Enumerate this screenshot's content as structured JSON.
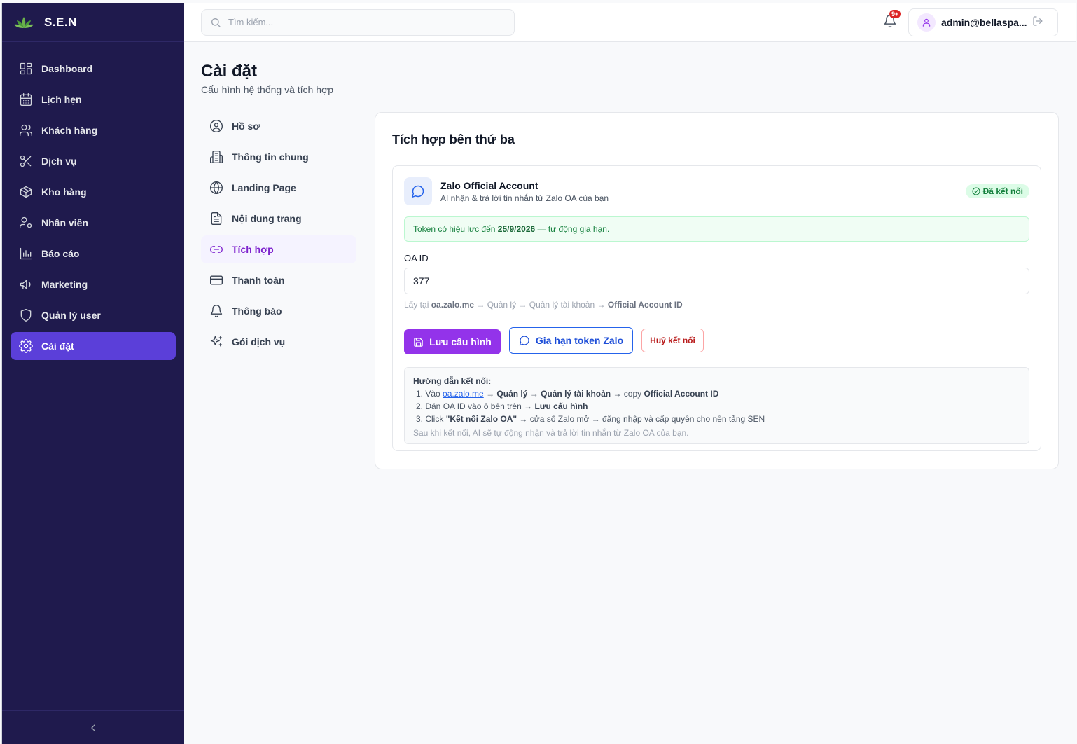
{
  "brand": {
    "name": "S.E.N"
  },
  "sidebar": {
    "items": [
      {
        "label": "Dashboard",
        "icon": "grid-icon"
      },
      {
        "label": "Lịch hẹn",
        "icon": "calendar-icon"
      },
      {
        "label": "Khách hàng",
        "icon": "users-icon"
      },
      {
        "label": "Dịch vụ",
        "icon": "scissors-icon"
      },
      {
        "label": "Kho hàng",
        "icon": "package-icon"
      },
      {
        "label": "Nhân viên",
        "icon": "user-cog-icon"
      },
      {
        "label": "Báo cáo",
        "icon": "bar-chart-icon"
      },
      {
        "label": "Marketing",
        "icon": "megaphone-icon"
      },
      {
        "label": "Quản lý user",
        "icon": "shield-icon"
      },
      {
        "label": "Cài đặt",
        "icon": "gear-icon",
        "active": true
      }
    ]
  },
  "topbar": {
    "search_placeholder": "Tìm kiếm...",
    "notification_count": "9+",
    "user_email": "admin@bellaspa..."
  },
  "page": {
    "title": "Cài đặt",
    "subtitle": "Cấu hình hệ thống và tích hợp"
  },
  "settings_nav": {
    "items": [
      {
        "label": "Hồ sơ",
        "icon": "user-circle-icon"
      },
      {
        "label": "Thông tin chung",
        "icon": "building-icon"
      },
      {
        "label": "Landing Page",
        "icon": "globe-icon"
      },
      {
        "label": "Nội dung trang",
        "icon": "file-text-icon"
      },
      {
        "label": "Tích hợp",
        "icon": "link-icon",
        "active": true
      },
      {
        "label": "Thanh toán",
        "icon": "credit-card-icon"
      },
      {
        "label": "Thông báo",
        "icon": "bell-icon"
      },
      {
        "label": "Gói dịch vụ",
        "icon": "sparkles-icon"
      }
    ]
  },
  "card": {
    "title": "Tích hợp bên thứ ba",
    "integration": {
      "name": "Zalo Official Account",
      "description": "AI nhận & trả lời tin nhắn từ Zalo OA của bạn",
      "status": "Đã kết nối",
      "token_prefix": "Token có hiệu lực đến ",
      "token_date": "25/9/2026",
      "token_suffix": " — tự động gia hạn.",
      "field_label": "OA ID",
      "field_value": "377",
      "hint_prefix": "Lấy tại ",
      "hint_site": "oa.zalo.me",
      "hint_middle": " → Quản lý → Quản lý tài khoản → ",
      "hint_target": "Official Account ID",
      "save_button": "Lưu cấu hình",
      "renew_button": "Gia hạn token Zalo",
      "disconnect_button": "Huỷ kết nối",
      "guide": {
        "title": "Hướng dẫn kết nối:",
        "step1_a": "1. Vào ",
        "step1_link": "oa.zalo.me",
        "step1_b": " → ",
        "step1_c": "Quản lý",
        "step1_d": " → ",
        "step1_e": "Quản lý tài khoản",
        "step1_f": " → copy ",
        "step1_g": "Official Account ID",
        "step2_a": "2. Dán OA ID vào ô bên trên → ",
        "step2_b": "Lưu cấu hình",
        "step3_a": "3. Click ",
        "step3_b": "\"Kết nối Zalo OA\"",
        "step3_c": " → cửa sổ Zalo mở → đăng nhập và cấp quyền cho nền tảng SEN",
        "note": "Sau khi kết nối, AI sẽ tự động nhận và trả lời tin nhắn từ Zalo OA của bạn."
      }
    }
  },
  "colors": {
    "sidebar_bg": "#1f1a4d",
    "sidebar_active": "#5b3fd9",
    "primary": "#9333ea",
    "success": "#15803d",
    "danger": "#b91c1c"
  }
}
